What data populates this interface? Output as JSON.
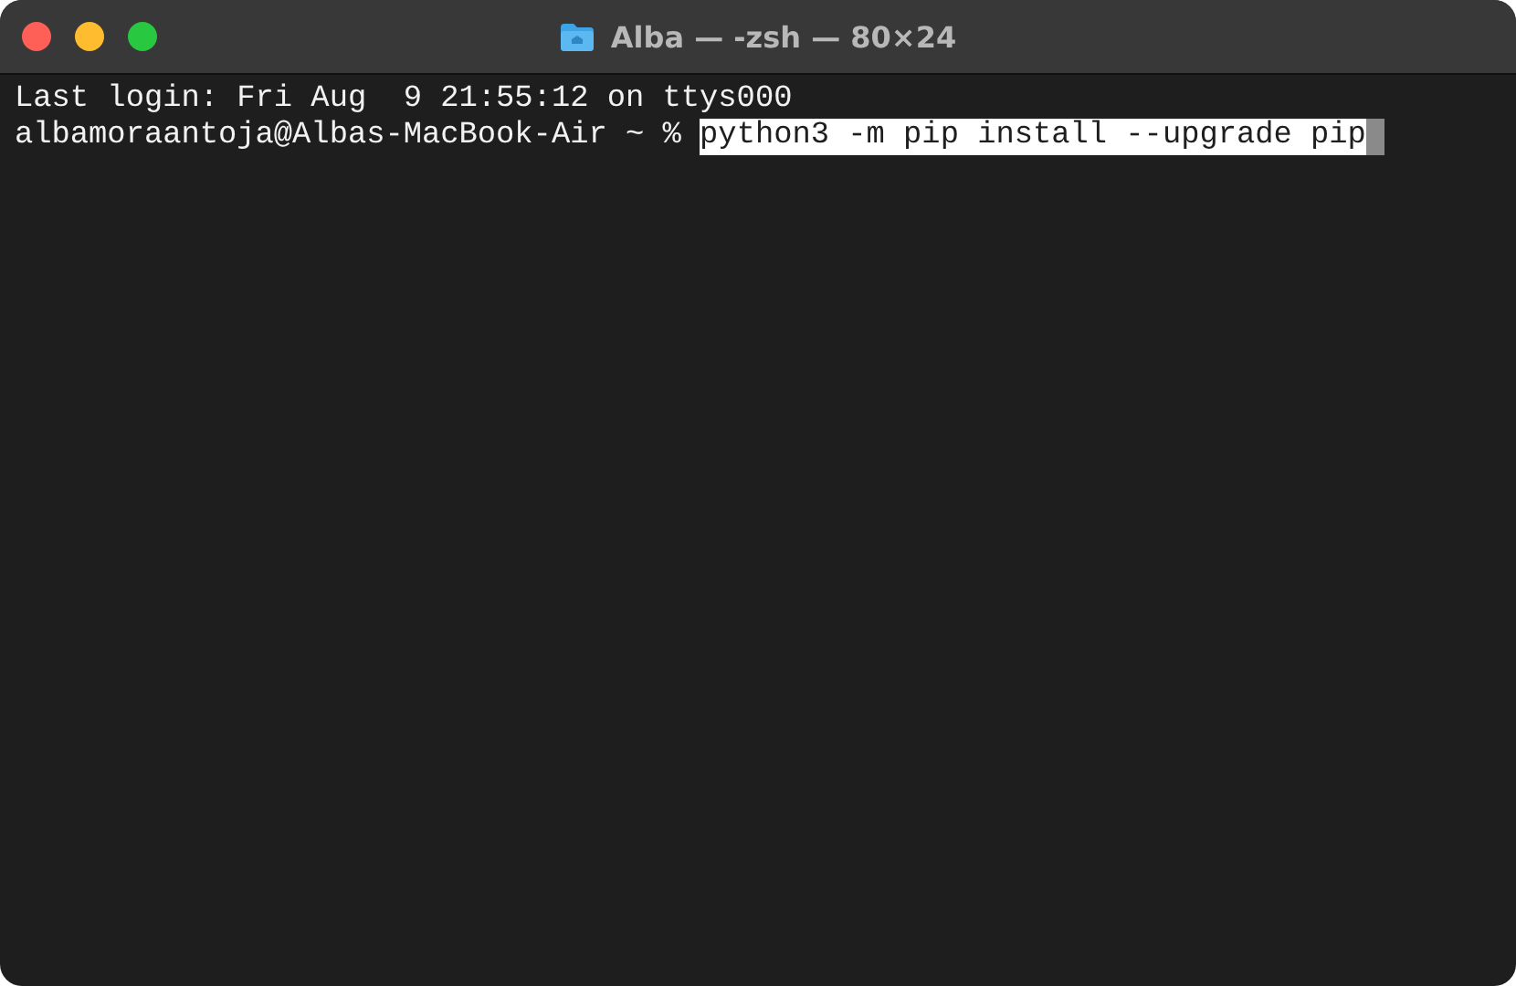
{
  "window": {
    "title": "Alba — -zsh — 80×24"
  },
  "lines": [
    {
      "segments": [
        {
          "text": "Last login: Fri Aug  9 21:55:12 on ttys000",
          "selected": false
        }
      ]
    },
    {
      "segments": [
        {
          "text": "albamoraantoja@Albas-MacBook-Air ~ % ",
          "selected": false
        },
        {
          "text": "python3 -m pip install --upgrade pip",
          "selected": true
        }
      ],
      "cursor": true
    }
  ]
}
